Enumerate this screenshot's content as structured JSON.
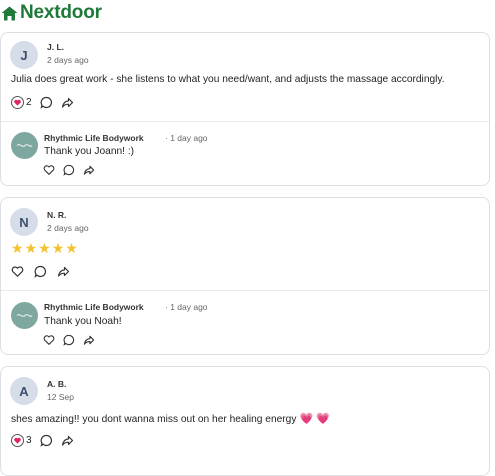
{
  "app": {
    "name": "Nextdoor",
    "brand_color": "#1f7a3a"
  },
  "reviews": [
    {
      "initial": "J",
      "author": "J. L.",
      "time": "2 days ago",
      "text": "Julia does great work - she listens to what you need/want, and adjusts the massage accordingly.",
      "reaction_count": "2",
      "reply": {
        "author": "Rhythmic Life Bodywork",
        "time": "· 1 day ago",
        "text": "Thank you Joann! :)"
      }
    },
    {
      "initial": "N",
      "author": "N. R.",
      "time": "2 days ago",
      "rating": 5,
      "reply": {
        "author": "Rhythmic Life Bodywork",
        "time": "· 1 day ago",
        "text": "Thank you Noah!"
      }
    },
    {
      "initial": "A",
      "author": "A. B.",
      "time": "12 Sep",
      "text": "shes amazing!! you dont wanna miss out on her healing energy",
      "emoji": "💗 💗",
      "reaction_count": "3"
    }
  ]
}
